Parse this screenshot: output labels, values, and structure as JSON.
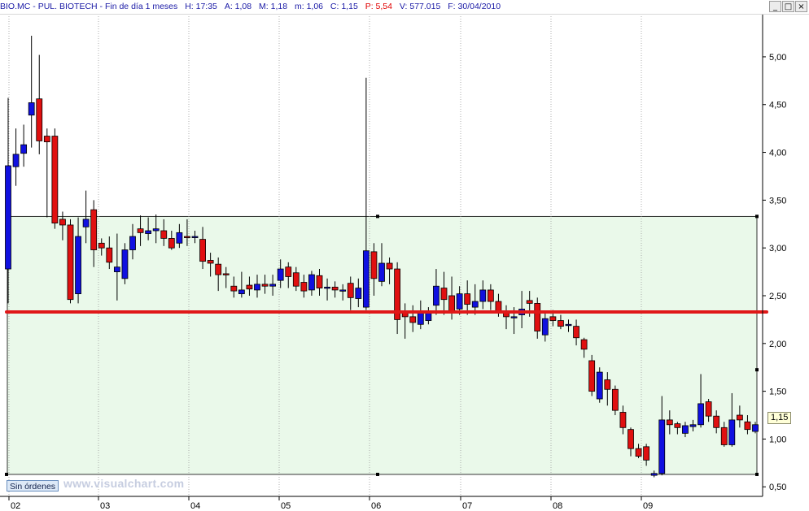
{
  "header": {
    "symbol": "BIO.MC",
    "separator": "-",
    "name": "PUL. BIOTECH",
    "separator2": "-",
    "period": "Fin de día 1 meses",
    "h_label": "H:",
    "h_value": "17:35",
    "a_label": "A:",
    "a_value": "1,08",
    "m_label": "M:",
    "m_value": "1,18",
    "mn_label": "m:",
    "mn_value": "1,06",
    "c_label": "C:",
    "c_value": "1,15",
    "p_label": "P:",
    "p_value": "5,54",
    "v_label": "V:",
    "v_value": "577.015",
    "f_label": "F:",
    "f_value": "30/04/2010"
  },
  "window_controls": [
    "_",
    "□",
    "×"
  ],
  "status_button": "Sin órdenes",
  "watermark": "www.visualchart.com",
  "last_price_label": "1,15",
  "colors": {
    "up": "#1010e0",
    "down": "#e01010",
    "zone_fill": "#eaf9ea",
    "support_line": "#e01818",
    "grid": "#9a9a9a"
  },
  "chart_data": {
    "type": "candlestick",
    "ylim": [
      0.4,
      5.45
    ],
    "y_ticks": [
      "0,50",
      "1,00",
      "1,50",
      "2,00",
      "2,50",
      "3,00",
      "3,50",
      "4,00",
      "4,50",
      "5,00"
    ],
    "y_tick_values": [
      0.5,
      1.0,
      1.5,
      2.0,
      2.5,
      3.0,
      3.5,
      4.0,
      4.5,
      5.0
    ],
    "x_ticks": [
      "02",
      "03",
      "04",
      "05",
      "06",
      "07",
      "08",
      "09"
    ],
    "zone": {
      "low": 0.63,
      "high": 3.33
    },
    "support_level": 2.33,
    "candles": [
      [
        2.78,
        3.86,
        2.42,
        4.57
      ],
      [
        3.85,
        3.98,
        3.65,
        4.25
      ],
      [
        3.99,
        4.08,
        3.85,
        4.29
      ],
      [
        4.39,
        4.52,
        4.05,
        5.22
      ],
      [
        4.56,
        4.12,
        3.98,
        5.02
      ],
      [
        4.17,
        4.11,
        3.32,
        4.25
      ],
      [
        4.17,
        3.26,
        3.2,
        4.25
      ],
      [
        3.3,
        3.24,
        3.08,
        3.38
      ],
      [
        3.24,
        2.46,
        2.42,
        3.3
      ],
      [
        2.52,
        3.12,
        2.42,
        3.32
      ],
      [
        3.22,
        3.3,
        3.05,
        3.6
      ],
      [
        3.4,
        2.98,
        2.8,
        3.5
      ],
      [
        3.05,
        3.0,
        2.92,
        3.1
      ],
      [
        3.0,
        2.85,
        2.78,
        3.12
      ],
      [
        2.75,
        2.8,
        2.45,
        3.15
      ],
      [
        2.68,
        2.98,
        2.62,
        3.05
      ],
      [
        2.98,
        3.12,
        2.88,
        3.25
      ],
      [
        3.2,
        3.16,
        3.02,
        3.34
      ],
      [
        3.15,
        3.18,
        3.08,
        3.32
      ],
      [
        3.18,
        3.2,
        3.05,
        3.35
      ],
      [
        3.18,
        3.1,
        3.02,
        3.3
      ],
      [
        3.1,
        3.0,
        2.98,
        3.18
      ],
      [
        3.05,
        3.16,
        3.0,
        3.25
      ],
      [
        3.12,
        3.11,
        3.02,
        3.3
      ],
      [
        3.11,
        3.12,
        3.05,
        3.18
      ],
      [
        3.09,
        2.86,
        2.78,
        3.22
      ],
      [
        2.87,
        2.84,
        2.7,
        2.95
      ],
      [
        2.83,
        2.72,
        2.55,
        2.9
      ],
      [
        2.73,
        2.72,
        2.58,
        2.8
      ],
      [
        2.6,
        2.55,
        2.48,
        2.7
      ],
      [
        2.52,
        2.56,
        2.48,
        2.75
      ],
      [
        2.61,
        2.57,
        2.5,
        2.7
      ],
      [
        2.56,
        2.62,
        2.48,
        2.72
      ],
      [
        2.62,
        2.6,
        2.52,
        2.72
      ],
      [
        2.6,
        2.62,
        2.5,
        2.72
      ],
      [
        2.66,
        2.78,
        2.58,
        2.88
      ],
      [
        2.8,
        2.7,
        2.58,
        2.85
      ],
      [
        2.74,
        2.6,
        2.55,
        2.8
      ],
      [
        2.64,
        2.55,
        2.48,
        2.72
      ],
      [
        2.56,
        2.72,
        2.5,
        2.76
      ],
      [
        2.71,
        2.58,
        2.5,
        2.78
      ],
      [
        2.58,
        2.59,
        2.45,
        2.68
      ],
      [
        2.59,
        2.56,
        2.48,
        2.65
      ],
      [
        2.55,
        2.56,
        2.45,
        2.62
      ],
      [
        2.63,
        2.48,
        2.35,
        2.7
      ],
      [
        2.47,
        2.58,
        2.38,
        2.68
      ],
      [
        2.38,
        2.97,
        2.35,
        4.78
      ],
      [
        2.96,
        2.68,
        2.5,
        3.05
      ],
      [
        2.65,
        2.84,
        2.6,
        3.05
      ],
      [
        2.84,
        2.78,
        2.62,
        2.9
      ],
      [
        2.78,
        2.25,
        2.1,
        2.85
      ],
      [
        2.32,
        2.28,
        2.05,
        2.42
      ],
      [
        2.28,
        2.22,
        2.12,
        2.4
      ],
      [
        2.2,
        2.34,
        2.15,
        2.45
      ],
      [
        2.24,
        2.32,
        2.2,
        2.38
      ],
      [
        2.4,
        2.6,
        2.3,
        2.78
      ],
      [
        2.58,
        2.46,
        2.3,
        2.75
      ],
      [
        2.5,
        2.34,
        2.25,
        2.7
      ],
      [
        2.36,
        2.52,
        2.3,
        2.6
      ],
      [
        2.52,
        2.41,
        2.3,
        2.66
      ],
      [
        2.38,
        2.44,
        2.3,
        2.62
      ],
      [
        2.44,
        2.56,
        2.36,
        2.66
      ],
      [
        2.56,
        2.44,
        2.35,
        2.62
      ],
      [
        2.44,
        2.32,
        2.28,
        2.52
      ],
      [
        2.32,
        2.28,
        2.15,
        2.4
      ],
      [
        2.27,
        2.28,
        2.1,
        2.38
      ],
      [
        2.3,
        2.36,
        2.16,
        2.55
      ],
      [
        2.45,
        2.42,
        2.28,
        2.55
      ],
      [
        2.42,
        2.13,
        2.05,
        2.48
      ],
      [
        2.09,
        2.26,
        2.02,
        2.32
      ],
      [
        2.28,
        2.24,
        2.18,
        2.35
      ],
      [
        2.24,
        2.18,
        2.15,
        2.3
      ],
      [
        2.19,
        2.2,
        2.12,
        2.25
      ],
      [
        2.18,
        2.06,
        1.98,
        2.25
      ],
      [
        2.04,
        1.94,
        1.85,
        2.06
      ],
      [
        1.82,
        1.5,
        1.45,
        1.88
      ],
      [
        1.42,
        1.7,
        1.38,
        1.75
      ],
      [
        1.62,
        1.52,
        1.35,
        1.7
      ],
      [
        1.52,
        1.3,
        1.25,
        1.56
      ],
      [
        1.28,
        1.12,
        1.05,
        1.35
      ],
      [
        1.1,
        0.9,
        0.82,
        1.12
      ],
      [
        0.9,
        0.82,
        0.8,
        0.95
      ],
      [
        0.92,
        0.78,
        0.72,
        0.95
      ],
      [
        0.62,
        0.64,
        0.6,
        0.67
      ],
      [
        0.64,
        1.2,
        0.62,
        1.45
      ],
      [
        1.2,
        1.15,
        1.05,
        1.3
      ],
      [
        1.16,
        1.12,
        1.05,
        1.18
      ],
      [
        1.06,
        1.14,
        1.02,
        1.18
      ],
      [
        1.13,
        1.15,
        1.08,
        1.2
      ],
      [
        1.15,
        1.37,
        1.12,
        1.68
      ],
      [
        1.39,
        1.24,
        1.18,
        1.42
      ],
      [
        1.24,
        1.12,
        1.06,
        1.3
      ],
      [
        1.12,
        0.94,
        0.92,
        1.18
      ],
      [
        0.94,
        1.2,
        0.92,
        1.48
      ],
      [
        1.25,
        1.2,
        1.12,
        1.35
      ],
      [
        1.18,
        1.1,
        1.05,
        1.25
      ],
      [
        1.08,
        1.15,
        1.06,
        1.18
      ]
    ]
  }
}
